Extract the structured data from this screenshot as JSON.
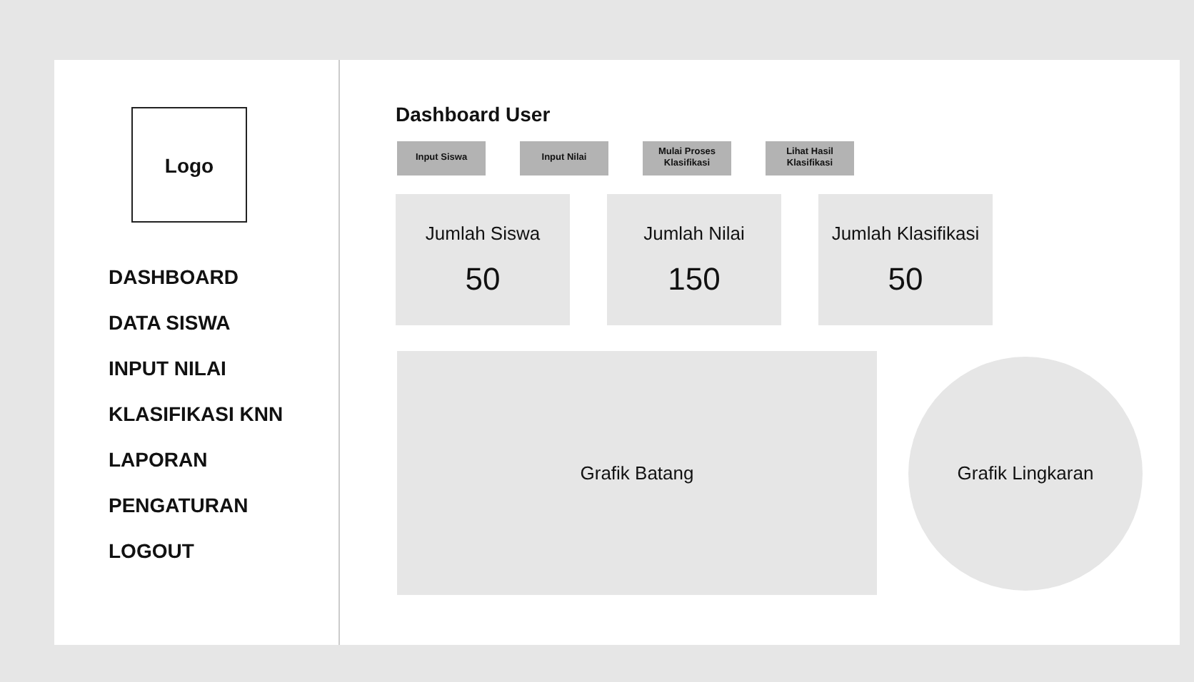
{
  "sidebar": {
    "logo": "Logo",
    "items": [
      {
        "label": "DASHBOARD"
      },
      {
        "label": "DATA SISWA"
      },
      {
        "label": "INPUT NILAI"
      },
      {
        "label": "KLASIFIKASI KNN"
      },
      {
        "label": "LAPORAN"
      },
      {
        "label": "PENGATURAN"
      },
      {
        "label": "LOGOUT"
      }
    ]
  },
  "title": "Dashboard User",
  "buttons": [
    "Input Siswa",
    "Input Nilai",
    "Mulai Proses Klasifikasi",
    "Lihat Hasil Klasifikasi"
  ],
  "stats": [
    {
      "label": "Jumlah Siswa",
      "value": "50"
    },
    {
      "label": "Jumlah Nilai",
      "value": "150"
    },
    {
      "label": "Jumlah Klasifikasi",
      "value": "50"
    }
  ],
  "bar_chart": {
    "label": "Grafik Batang"
  },
  "pie_chart": {
    "label": "Grafik Lingkaran"
  }
}
